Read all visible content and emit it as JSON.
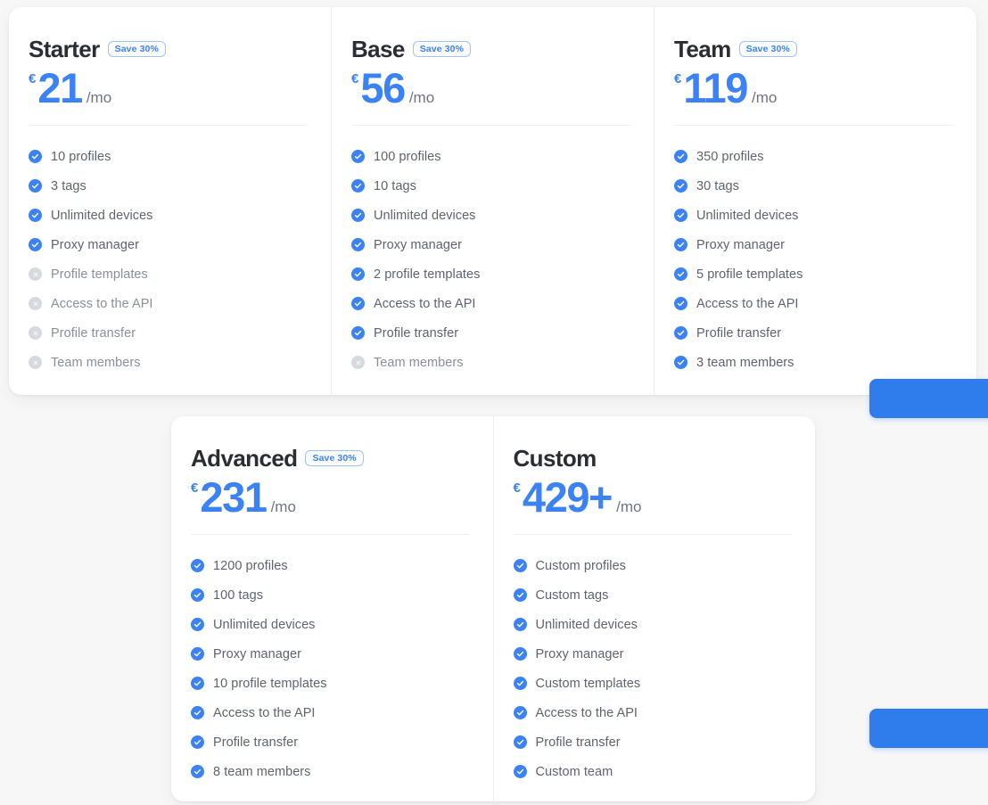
{
  "page": {
    "background_color": "#f7f7f8",
    "accent_color": "#3b82f6",
    "muted_icon_color": "#d6d9de"
  },
  "currency_symbol": "€",
  "period_label": "/mo",
  "badge_label": "Save 30%",
  "rows": [
    {
      "name": "top-row",
      "plans": [
        {
          "id": "starter",
          "name": "Starter",
          "badge": "Save 30%",
          "currency": "€",
          "price": "21",
          "period": "/mo",
          "features": [
            {
              "label": "10 profiles",
              "included": true
            },
            {
              "label": "3 tags",
              "included": true
            },
            {
              "label": "Unlimited devices",
              "included": true
            },
            {
              "label": "Proxy manager",
              "included": true
            },
            {
              "label": "Profile templates",
              "included": false
            },
            {
              "label": "Access to the API",
              "included": false
            },
            {
              "label": "Profile transfer",
              "included": false
            },
            {
              "label": "Team members",
              "included": false
            }
          ]
        },
        {
          "id": "base",
          "name": "Base",
          "badge": "Save 30%",
          "currency": "€",
          "price": "56",
          "period": "/mo",
          "features": [
            {
              "label": "100 profiles",
              "included": true
            },
            {
              "label": "10 tags",
              "included": true
            },
            {
              "label": "Unlimited devices",
              "included": true
            },
            {
              "label": "Proxy manager",
              "included": true
            },
            {
              "label": "2 profile templates",
              "included": true
            },
            {
              "label": "Access to the API",
              "included": true
            },
            {
              "label": "Profile transfer",
              "included": true
            },
            {
              "label": "Team members",
              "included": false
            }
          ]
        },
        {
          "id": "team",
          "name": "Team",
          "badge": "Save 30%",
          "currency": "€",
          "price": "119",
          "period": "/mo",
          "features": [
            {
              "label": "350 profiles",
              "included": true
            },
            {
              "label": "30 tags",
              "included": true
            },
            {
              "label": "Unlimited devices",
              "included": true
            },
            {
              "label": "Proxy manager",
              "included": true
            },
            {
              "label": "5 profile templates",
              "included": true
            },
            {
              "label": "Access to the API",
              "included": true
            },
            {
              "label": "Profile transfer",
              "included": true
            },
            {
              "label": "3 team members",
              "included": true
            }
          ]
        }
      ]
    },
    {
      "name": "bottom-row",
      "plans": [
        {
          "id": "advanced",
          "name": "Advanced",
          "badge": "Save 30%",
          "currency": "€",
          "price": "231",
          "period": "/mo",
          "features": [
            {
              "label": "1200 profiles",
              "included": true
            },
            {
              "label": "100 tags",
              "included": true
            },
            {
              "label": "Unlimited devices",
              "included": true
            },
            {
              "label": "Proxy manager",
              "included": true
            },
            {
              "label": "10 profile templates",
              "included": true
            },
            {
              "label": "Access to the API",
              "included": true
            },
            {
              "label": "Profile transfer",
              "included": true
            },
            {
              "label": "8 team members",
              "included": true
            }
          ]
        },
        {
          "id": "custom",
          "name": "Custom",
          "badge": null,
          "currency": "€",
          "price": "429+",
          "period": "/mo",
          "features": [
            {
              "label": "Custom profiles",
              "included": true
            },
            {
              "label": "Custom tags",
              "included": true
            },
            {
              "label": "Unlimited devices",
              "included": true
            },
            {
              "label": "Proxy manager",
              "included": true
            },
            {
              "label": "Custom templates",
              "included": true
            },
            {
              "label": "Access to the API",
              "included": true
            },
            {
              "label": "Profile transfer",
              "included": true
            },
            {
              "label": "Custom team",
              "included": true
            }
          ]
        }
      ]
    }
  ],
  "clipped_buttons": [
    {
      "id": "cta-top",
      "color": "#2f7ced"
    },
    {
      "id": "cta-bottom",
      "color": "#2f7ced"
    }
  ]
}
